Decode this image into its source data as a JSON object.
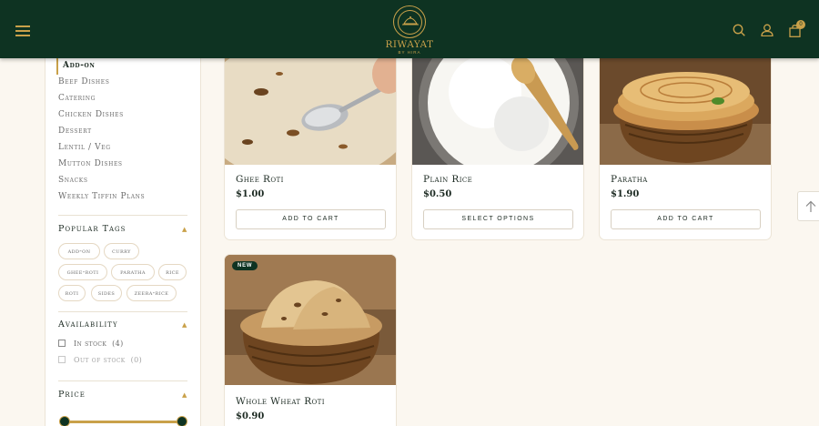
{
  "header": {
    "logo_name": "RIWAYAT",
    "logo_sub": "BY HIRA",
    "cart_count": "0",
    "icons": [
      "menu-icon",
      "search-icon",
      "user-icon",
      "cart-icon"
    ]
  },
  "sidebar": {
    "categories": [
      {
        "label": "Add-on",
        "active": true
      },
      {
        "label": "Beef Dishes"
      },
      {
        "label": "Catering"
      },
      {
        "label": "Chicken Dishes"
      },
      {
        "label": "Dessert"
      },
      {
        "label": "Lentil / Veg"
      },
      {
        "label": "Mutton Dishes"
      },
      {
        "label": "Snacks"
      },
      {
        "label": "Weekly Tiffin Plans"
      }
    ],
    "popular_tags": {
      "title": "Popular Tags",
      "tags": [
        "add-on",
        "curry",
        "ghee-roti",
        "paratha",
        "rice",
        "roti",
        "sides",
        "zeera-rice"
      ]
    },
    "availability": {
      "title": "Availability",
      "options": [
        {
          "label": "In stock",
          "count": "(4)"
        },
        {
          "label": "Out of stock",
          "count": "(0)"
        }
      ]
    },
    "price": {
      "title": "Price"
    }
  },
  "products": [
    {
      "title": "Ghee Roti",
      "price": "$1.00",
      "button": "ADD TO CART"
    },
    {
      "title": "Plain Rice",
      "price": "$0.50",
      "button": "SELECT OPTIONS"
    },
    {
      "title": "Paratha",
      "price": "$1.90",
      "button": "ADD TO CART"
    },
    {
      "title": "Whole Wheat Roti",
      "price": "$0.90",
      "badge": "NEW"
    }
  ],
  "colors": {
    "brand_green": "#0e3322",
    "gold": "#c9a14a",
    "background": "#fbf7f0"
  }
}
